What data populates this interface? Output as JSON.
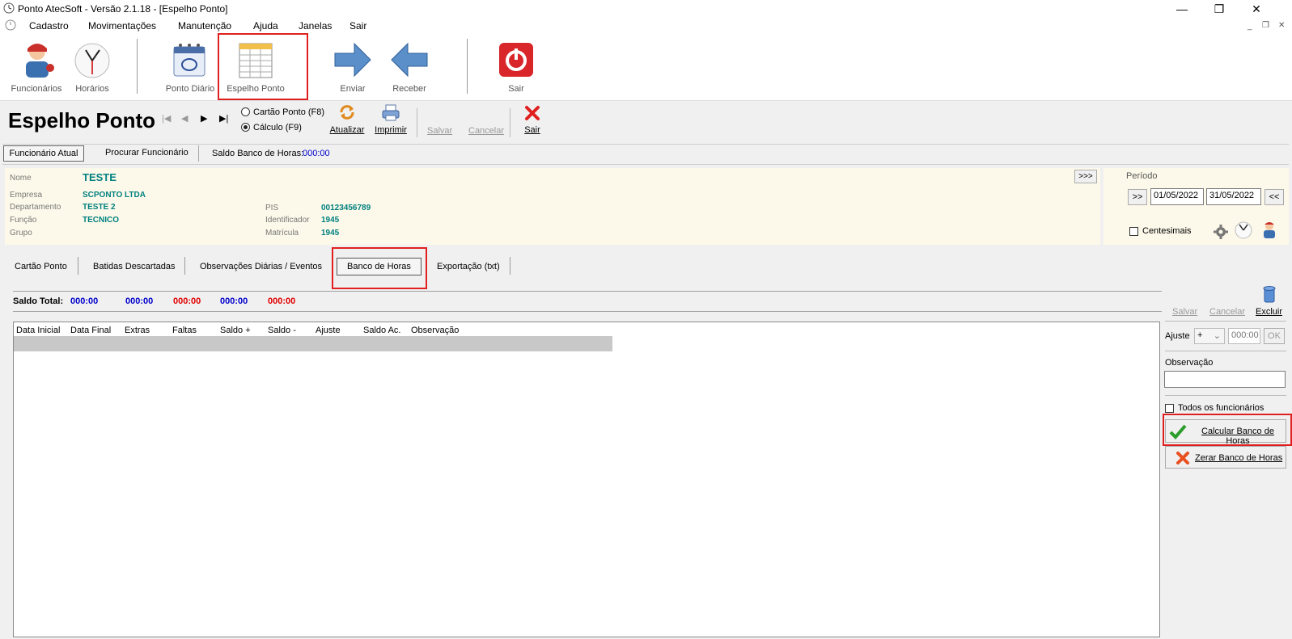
{
  "window": {
    "title": "Ponto AtecSoft - Versão 2.1.18 - [Espelho Ponto]"
  },
  "menu": [
    "Cadastro",
    "Movimentações",
    "Manutenção",
    "Ajuda",
    "Janelas",
    "Sair"
  ],
  "toolbar": {
    "funcionarios": "Funcionários",
    "horarios": "Horários",
    "ponto_diario": "Ponto Diário",
    "espelho_ponto": "Espelho Ponto",
    "enviar": "Enviar",
    "receber": "Receber",
    "sair": "Sair"
  },
  "page": {
    "title": "Espelho Ponto",
    "radio_cartao": "Cartão Ponto (F8)",
    "radio_calculo": "Cálculo (F9)",
    "atualizar": "Atualizar",
    "imprimir": "Imprimir",
    "salvar": "Salvar",
    "cancelar": "Cancelar",
    "sair": "Sair"
  },
  "subtabs": {
    "atual": "Funcionário Atual",
    "procurar": "Procurar Funcionário",
    "saldo_label": "Saldo Banco de Horas:",
    "saldo_value": "000:00"
  },
  "employee": {
    "nome_label": "Nome",
    "nome": "TESTE",
    "expand": ">>>",
    "empresa_label": "Empresa",
    "empresa": "SCPONTO LTDA",
    "departamento_label": "Departamento",
    "departamento": "TESTE 2",
    "funcao_label": "Função",
    "funcao": "TECNICO",
    "grupo_label": "Grupo",
    "pis_label": "PIS",
    "pis": "00123456789",
    "identificador_label": "Identificador",
    "identificador": "1945",
    "matricula_label": "Matrícula",
    "matricula": "1945"
  },
  "periodo": {
    "label": "Período",
    "next": ">>",
    "start": "01/05/2022",
    "end": "31/05/2022",
    "prev": "<<",
    "centesimais": "Centesimais"
  },
  "tabs": [
    "Cartão Ponto",
    "Batidas Descartadas",
    "Observações Diárias / Eventos",
    "Banco de Horas",
    "Exportação (txt)"
  ],
  "saldo": {
    "label": "Saldo Total:",
    "values": [
      "000:00",
      "000:00",
      "000:00",
      "000:00",
      "000:00"
    ],
    "colors": [
      "#0000cc",
      "#0000cc",
      "#e00000",
      "#0000cc",
      "#e00000"
    ]
  },
  "table": {
    "columns": [
      "Data Inicial",
      "Data Final",
      "Extras",
      "Faltas",
      "Saldo +",
      "Saldo -",
      "Ajuste",
      "Saldo Ac.",
      "Observação"
    ]
  },
  "side": {
    "salvar": "Salvar",
    "cancelar": "Cancelar",
    "excluir": "Excluir",
    "ajuste_label": "Ajuste",
    "ajuste_sign": "+",
    "ajuste_value": "000:00",
    "ok": "OK",
    "observacao_label": "Observação",
    "todos": "Todos os funcionários",
    "calcular": "Calcular Banco de Horas",
    "zerar": "Zerar Banco de Horas"
  }
}
